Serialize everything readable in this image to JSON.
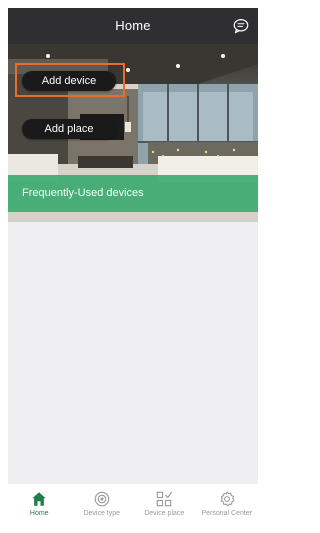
{
  "header": {
    "title": "Home",
    "icon": "chat-bubble-icon"
  },
  "hero": {
    "add_device_label": "Add device",
    "add_place_label": "Add place",
    "frequently_used_label": "Frequently-Used devices"
  },
  "bottom_nav": {
    "items": [
      {
        "label": "Home",
        "icon": "home-icon",
        "active": true
      },
      {
        "label": "Device type",
        "icon": "device-type-icon",
        "active": false
      },
      {
        "label": "Device place",
        "icon": "device-place-icon",
        "active": false
      },
      {
        "label": "Personal Center",
        "icon": "gear-icon",
        "active": false
      }
    ]
  },
  "colors": {
    "header_bg": "#2f2f31",
    "accent_green": "#2fa767",
    "active_tab": "#1f7d4d",
    "highlight": "#e96c2c",
    "content_bg": "#efeff1"
  }
}
